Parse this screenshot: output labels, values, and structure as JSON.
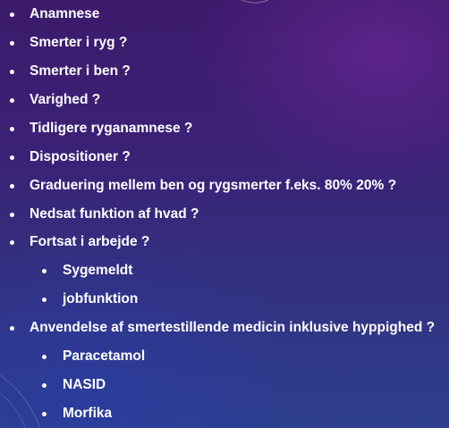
{
  "slide": {
    "items": [
      {
        "level": 1,
        "text": "Anamnese"
      },
      {
        "level": 1,
        "text": "Smerter i ryg ?"
      },
      {
        "level": 1,
        "text": "Smerter i ben ?"
      },
      {
        "level": 1,
        "text": "Varighed ?"
      },
      {
        "level": 1,
        "text": "Tidligere ryganamnese ?"
      },
      {
        "level": 1,
        "text": "Dispositioner ?"
      },
      {
        "level": 1,
        "text": "Graduering mellem ben og rygsmerter f.eks. 80% 20% ?"
      },
      {
        "level": 1,
        "text": "Nedsat funktion af hvad ?"
      },
      {
        "level": 1,
        "text": "Fortsat i arbejde ?"
      },
      {
        "level": 2,
        "text": "Sygemeldt"
      },
      {
        "level": 2,
        "text": "jobfunktion"
      },
      {
        "level": 1,
        "text": "Anvendelse af smertestillende medicin inklusive hyppighed ?"
      },
      {
        "level": 2,
        "text": "Paracetamol"
      },
      {
        "level": 2,
        "text": "NASID"
      },
      {
        "level": 2,
        "text": "Morfika"
      }
    ]
  },
  "colors": {
    "text": "#ffffff",
    "background_top": "#3c1a6b",
    "background_bottom": "#2d3f8e"
  }
}
